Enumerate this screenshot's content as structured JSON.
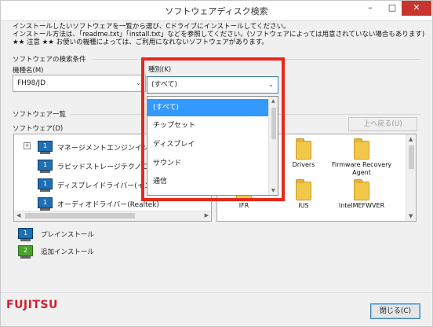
{
  "window": {
    "title": "ソフトウェアディスク検索",
    "minimize_glyph": "–",
    "maximize_glyph": "□",
    "close_glyph": "✕"
  },
  "instructions": [
    "インストールしたいソフトウェアを一覧から選び、Cドライブにインストールしてください。",
    "インストール方法は、「readme.txt」「install.txt」などを参照してください。(ソフトウェアによっては用意されていない場合もあります)",
    "★★ 注意 ★★ お使いの機種によっては、ご利用になれないソフトウェアがあります。"
  ],
  "search": {
    "group_label": "ソフトウェアの検索条件",
    "model_label": "機種名(M)",
    "model_value": "FH98/JD",
    "type_label": "種別(K)",
    "type_value": "(すべて)",
    "type_options": [
      "(すべて)",
      "チップセット",
      "ディスプレイ",
      "サウンド",
      "通信"
    ],
    "type_selected_index": 0
  },
  "software_list": {
    "group_label": "ソフトウェア一覧",
    "tree_label": "ソフトウェア(D)",
    "items": [
      {
        "label": "マネージメントエンジンインターフェイス",
        "expandable": true
      },
      {
        "label": "ラピッドストレージテクノロジードライバー",
        "expandable": false
      },
      {
        "label": "ディスプレイドライバー(インテル)",
        "expandable": false
      },
      {
        "label": "オーディオドライバー(Realtek)",
        "expandable": false
      }
    ]
  },
  "folders": [
    {
      "name": "Drivers"
    },
    {
      "name": "Firmware Recovery Agent"
    },
    {
      "name": "IFR"
    },
    {
      "name": "IUS"
    },
    {
      "name": "IntelMEFWVER"
    }
  ],
  "buttons": {
    "up_label": "上へ戻る(U)",
    "close_label": "閉じる(C)"
  },
  "legend": {
    "preinstall": "プレインストール",
    "addinstall": "追加インストール"
  },
  "brand": {
    "logo_text": "FUJITSU",
    "logo_color": "#d01f2e"
  },
  "colors": {
    "highlight": "#e8271a",
    "selection": "#3399ff",
    "close_button": "#c7352e"
  }
}
